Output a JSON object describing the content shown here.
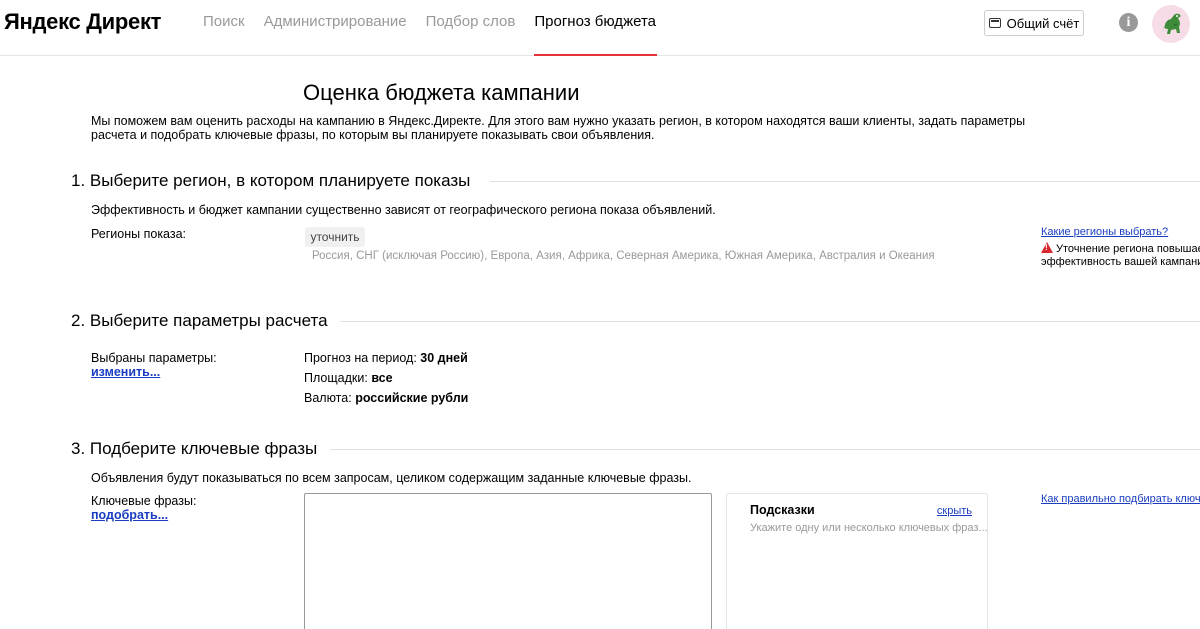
{
  "header": {
    "logo": "Яндекс Директ",
    "nav": [
      "Поиск",
      "Администрирование",
      "Подбор слов",
      "Прогноз бюджета"
    ],
    "active_tab_index": 3,
    "account_button": "Общий счёт",
    "info_glyph": "i"
  },
  "page": {
    "title": "Оценка бюджета кампании",
    "intro": "Мы поможем вам оценить расходы на кампанию в Яндекс.Директе. Для этого вам нужно указать регион, в котором находятся ваши клиенты, задать параметры расчета и подобрать ключевые фразы, по которым вы планируете показывать свои объявления."
  },
  "section1": {
    "title": "1. Выберите регион, в котором планируете показы",
    "description": "Эффективность и бюджет кампании существенно зависят от географического региона показа объявлений.",
    "regions_label": "Регионы показа:",
    "refine_button": "уточнить",
    "regions_list": "Россия, СНГ (исключая Россию), Европа, Азия, Африка, Северная Америка, Южная Америка, Австралия и Океания",
    "help_link": "Какие регионы выбрать?",
    "warning_line1": "Уточнение региона повышает",
    "warning_line2": "эффективность вашей кампании."
  },
  "section2": {
    "title": "2. Выберите параметры расчета",
    "params_label": "Выбраны параметры:",
    "change_link": "изменить...",
    "period_label": "Прогноз на период:",
    "period_value": "30 дней",
    "platforms_label": "Площадки:",
    "platforms_value": "все",
    "currency_label": "Валюта:",
    "currency_value": "российские рубли"
  },
  "section3": {
    "title": "3. Подберите ключевые фразы",
    "description": "Объявления будут показываться по всем запросам, целиком содержащим заданные ключевые фразы.",
    "keywords_label": "Ключевые фразы:",
    "pick_link": "подобрать...",
    "keywords_value": "",
    "hints_title": "Подсказки",
    "hints_hide": "скрыть",
    "hints_placeholder": "Укажите одну или несколько ключевых фраз...",
    "help_link": "Как правильно подбирать ключевые"
  },
  "colors": {
    "accent_red": "#e8333c",
    "link_blue": "#1a3dc1",
    "muted_grey": "#999999"
  }
}
